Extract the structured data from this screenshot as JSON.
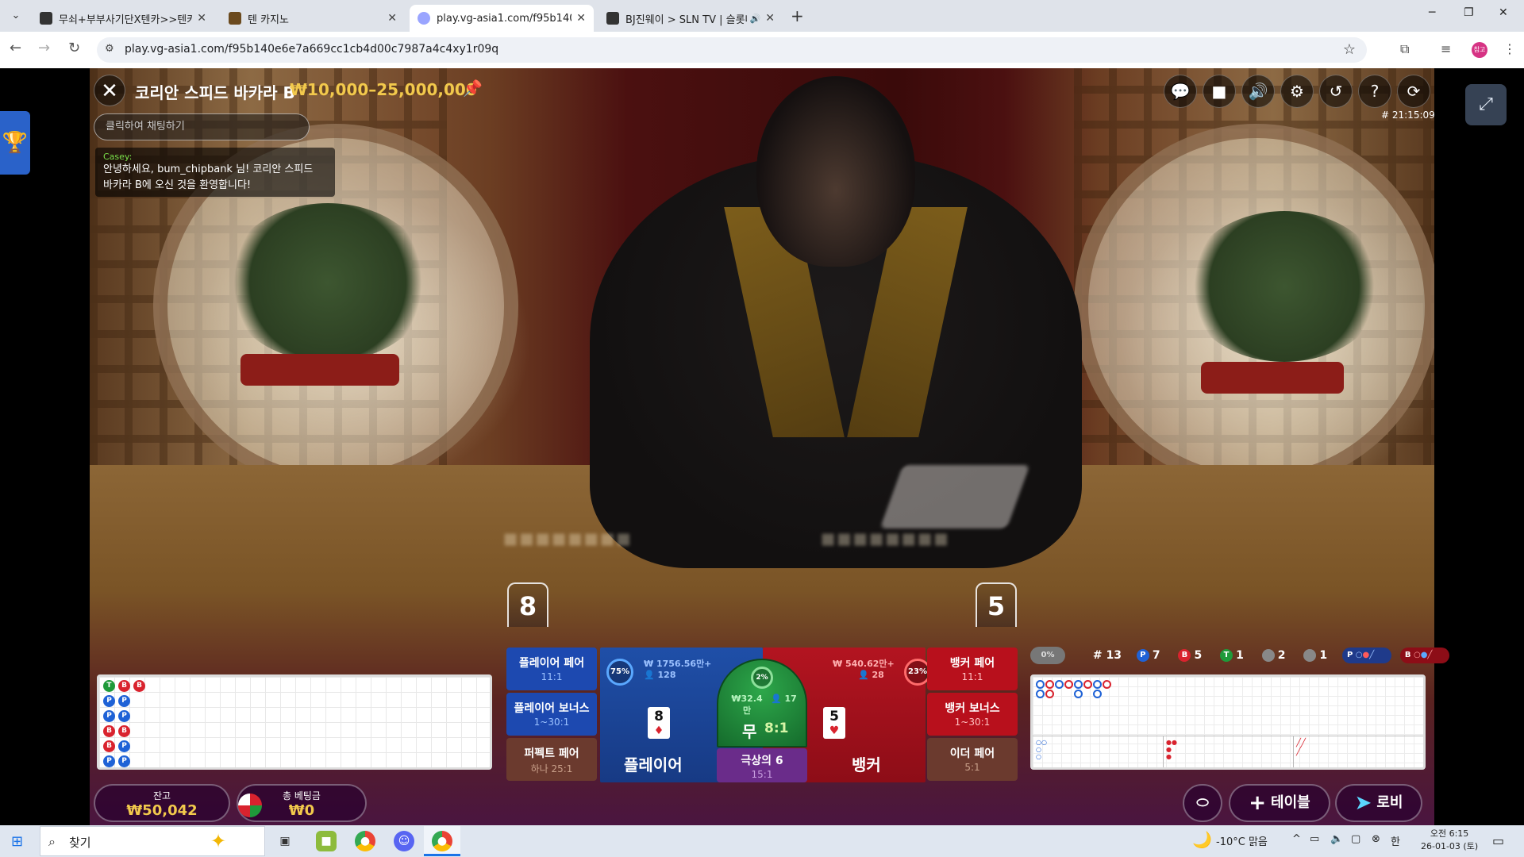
{
  "browser": {
    "tabs": [
      {
        "title": "무쇠+부부사기단X텐카>>텐카",
        "active": false
      },
      {
        "title": "텐 카지노",
        "active": false
      },
      {
        "title": "play.vg-asia1.com/f95b140e6e",
        "active": true
      },
      {
        "title": "BJ진웨이 > SLN TV | 슬롯나",
        "active": false,
        "audio": true
      }
    ],
    "url": "play.vg-asia1.com/f95b140e6e7a669cc1cb4d00c7987a4c4xy1r09q",
    "profile_badge": "참고"
  },
  "game": {
    "title": "코리안 스피드 바카라 B",
    "limit": "₩10,000–25,000,000",
    "round_id": "# 21:15:09",
    "chat_placeholder": "클릭하여 채팅하기",
    "chat": {
      "author": "Casey:",
      "line1": "안녕하세요, bum_chipbank 님! 코리안 스피드",
      "line2": "바카라 B에 오신 것을 환영합니다!"
    },
    "player_score": "8",
    "banker_score": "5",
    "controls": [
      "chat-icon",
      "video-icon",
      "volume-icon",
      "settings-icon",
      "history-icon",
      "help-icon",
      "refresh-icon"
    ]
  },
  "bets": {
    "player_pair": {
      "label": "플레이어 페어",
      "odds": "11:1"
    },
    "player_bonus": {
      "label": "플레이어 보너스",
      "odds": "1~30:1"
    },
    "perfect_pair": {
      "label": "퍼펙트 페어",
      "odds": "하나 25:1"
    },
    "player": {
      "label": "플레이어",
      "stake": "₩ 1756.56만+",
      "players": "128",
      "percent": "75%",
      "card_value": "8",
      "card_suit": "♦"
    },
    "tie": {
      "label": "무",
      "odds": "8:1",
      "stake": "₩32.4만",
      "players": "17",
      "percent": "2%"
    },
    "super6": {
      "label": "극상의 6",
      "odds": "15:1"
    },
    "banker": {
      "label": "뱅커",
      "stake": "₩ 540.62만+",
      "players": "28",
      "percent": "23%",
      "card_value": "5",
      "card_suit": "♥"
    },
    "banker_pair": {
      "label": "뱅커 페어",
      "odds": "11:1"
    },
    "banker_bonus": {
      "label": "뱅커 보너스",
      "odds": "1~30:1"
    },
    "either_pair": {
      "label": "이더 페어",
      "odds": "5:1"
    }
  },
  "stats": {
    "toggle": "0%",
    "round_no": "# 13",
    "player_count": "7",
    "banker_count": "5",
    "tie_count": "1",
    "player_pair_count": "2",
    "banker_pair_count": "1",
    "p_label": "P",
    "b_label": "B",
    "t_label": "T"
  },
  "footer": {
    "balance_label": "잔고",
    "balance": "₩50,042",
    "total_bet_label": "총 베팅금",
    "total_bet": "₩0",
    "table_btn": "테이블",
    "lobby_btn": "로비"
  },
  "taskbar": {
    "search_placeholder": "찾기",
    "weather": "-10°C 맑음",
    "ime": "한",
    "time": "오전 6:15",
    "date": "26-01-03 (토)"
  }
}
